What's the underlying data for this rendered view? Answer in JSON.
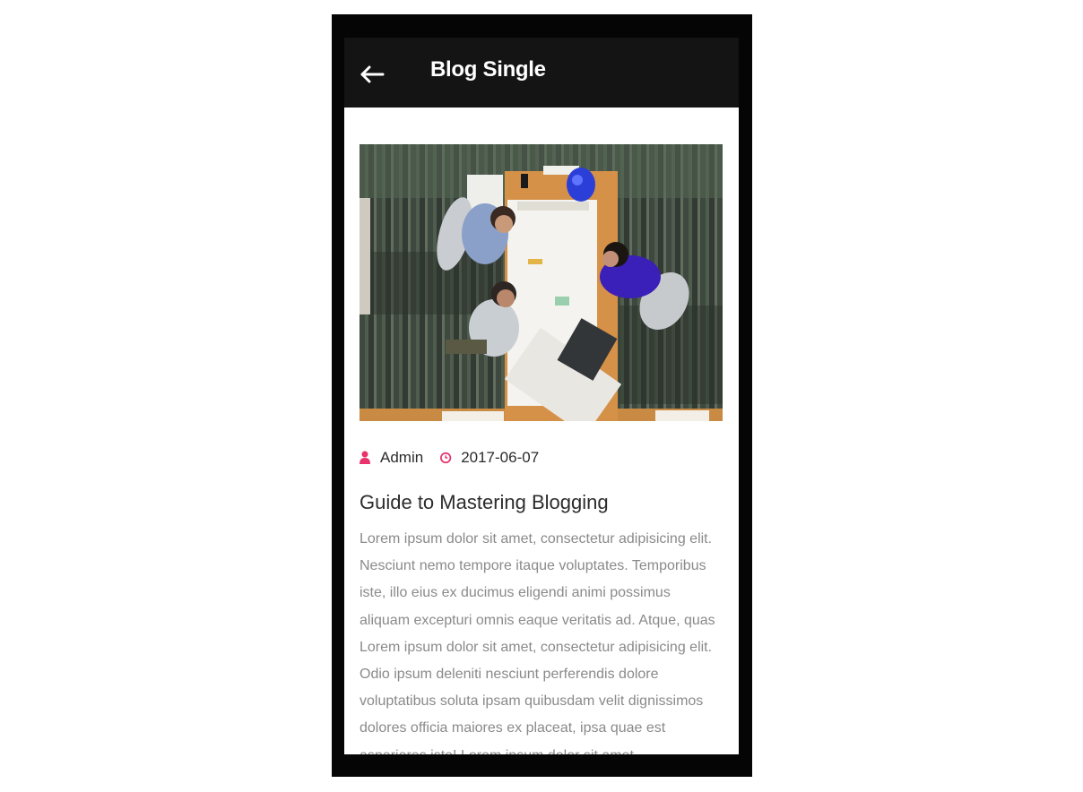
{
  "appbar": {
    "title": "Blog Single",
    "back_icon": "arrow-left-icon"
  },
  "post": {
    "image": "office-meeting-top-view",
    "author": "Admin",
    "author_icon": "user-icon",
    "date": "2017-06-07",
    "date_icon": "clock-icon",
    "title": "Guide to Mastering Blogging",
    "body": "Lorem ipsum dolor sit amet, consectetur adipisicing elit. Nesciunt nemo tempore itaque voluptates. Temporibus iste, illo eius ex ducimus eligendi animi possimus aliquam excepturi omnis eaque veritatis ad. Atque, quas Lorem ipsum dolor sit amet, consectetur adipisicing elit. Odio ipsum deleniti nesciunt perferendis dolore voluptatibus soluta ipsam quibusdam velit dignissimos dolores officia maiores ex placeat, ipsa quae est asperiores iste! Lorem ipsum dolor sit amet."
  },
  "colors": {
    "appbar_bg": "#141414",
    "accent": "#e8336c",
    "text_dark": "#2c2c2c",
    "text_muted": "#8a8a8a"
  }
}
